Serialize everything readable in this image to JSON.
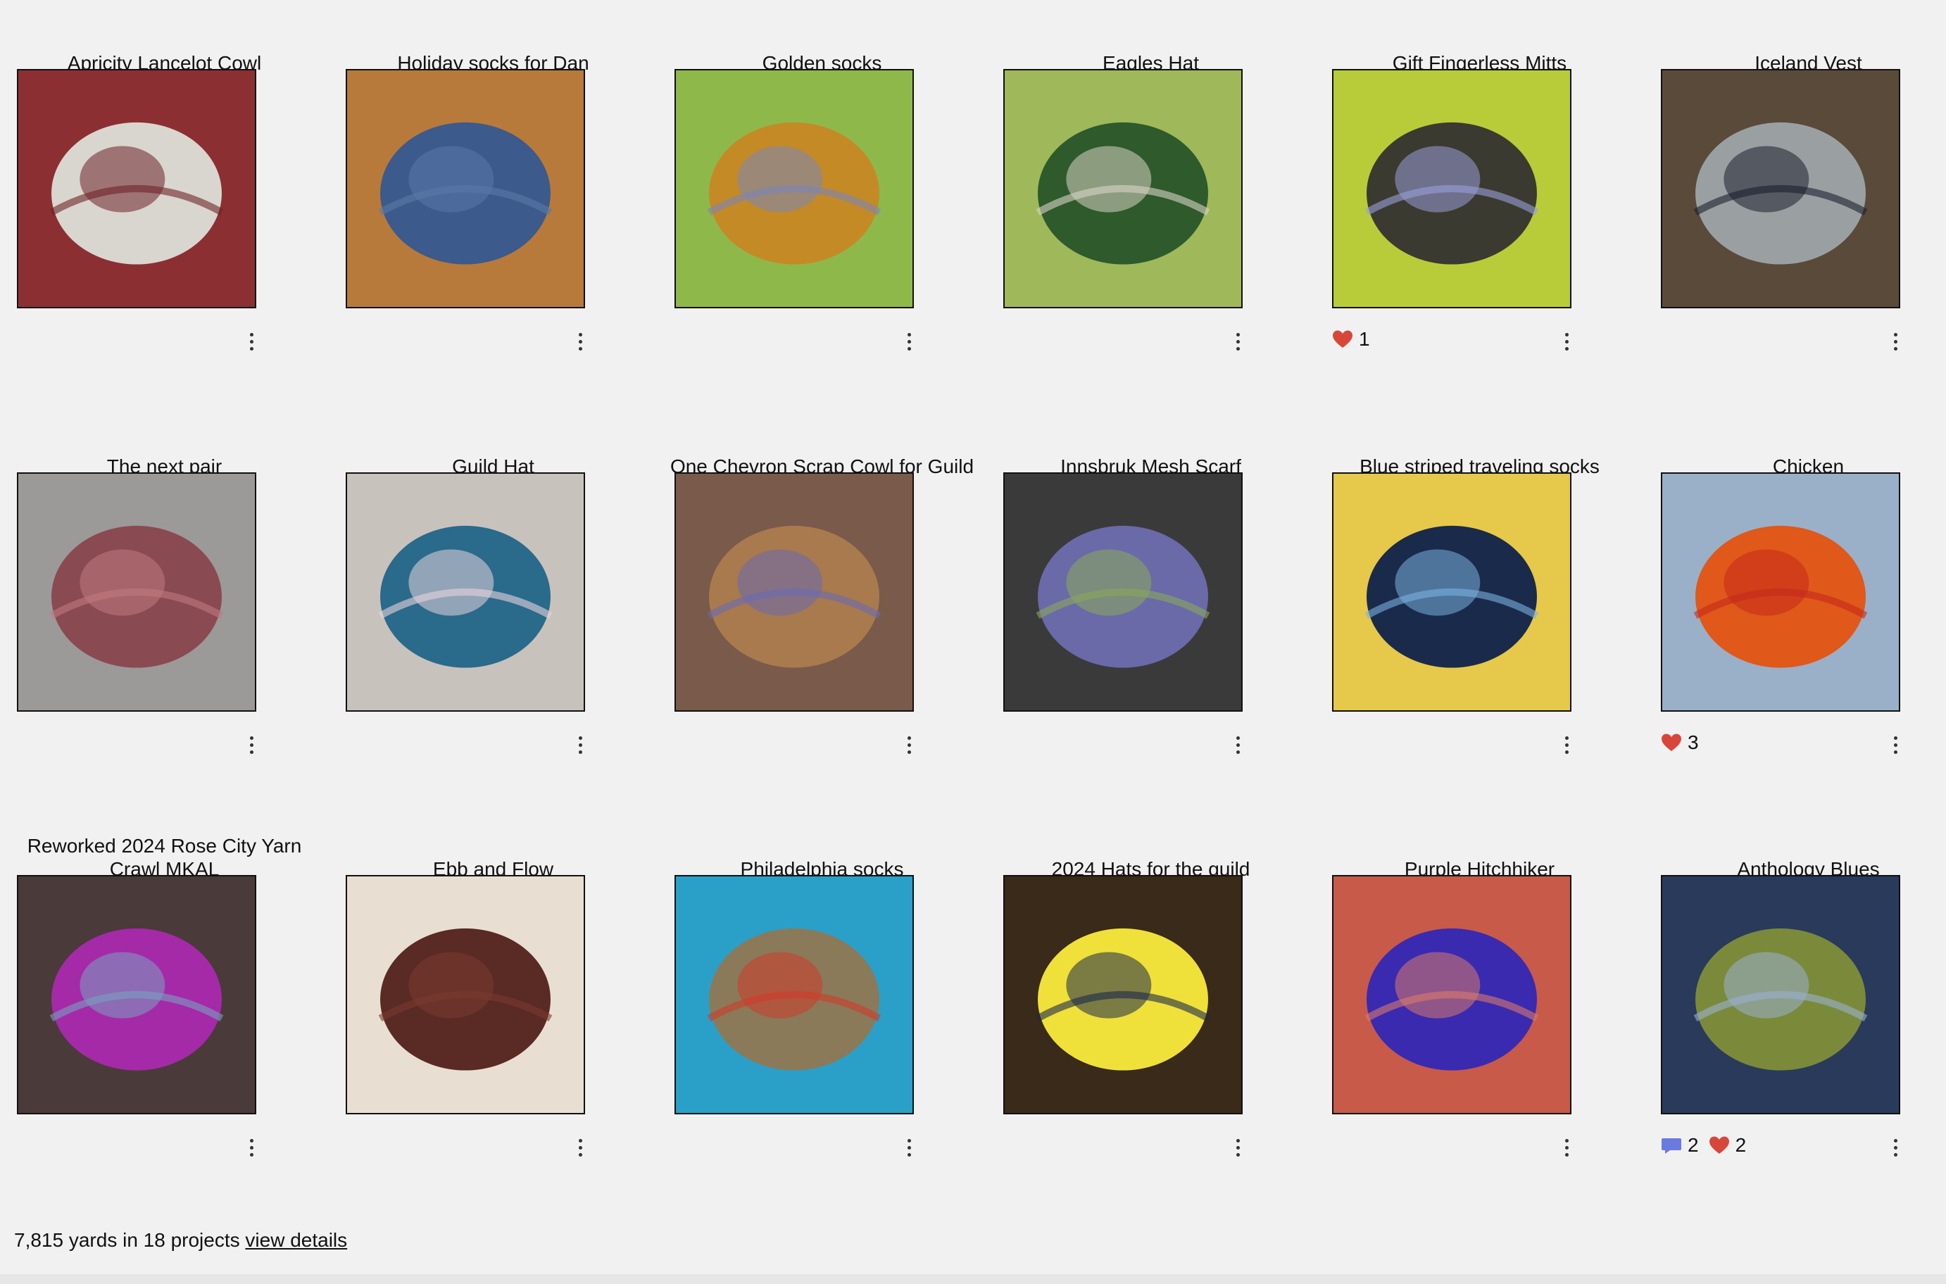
{
  "projects": [
    {
      "title": "Apricity Lancelot Cowl",
      "likes": "",
      "comments": "",
      "colors": [
        "#8b2f33",
        "#d9d6cf",
        "#6e2328"
      ]
    },
    {
      "title": "Holiday socks for Dan",
      "likes": "",
      "comments": "",
      "colors": [
        "#b87a3a",
        "#3c5a8c",
        "#5a79a8"
      ]
    },
    {
      "title": "Golden socks",
      "likes": "",
      "comments": "",
      "colors": [
        "#8fb84a",
        "#c48a26",
        "#7c86b8"
      ]
    },
    {
      "title": "Eagles Hat",
      "likes": "",
      "comments": "",
      "colors": [
        "#9fb85a",
        "#2e5a2c",
        "#d8d4c4"
      ]
    },
    {
      "title": "Gift Fingerless Mitts",
      "likes": "1",
      "comments": "",
      "colors": [
        "#b8cc3a",
        "#3b3a30",
        "#9a9fd8"
      ]
    },
    {
      "title": "Iceland Vest",
      "likes": "",
      "comments": "",
      "colors": [
        "#5a4a3a",
        "#9aa0a2",
        "#1c1f2e"
      ]
    },
    {
      "title": "The next pair",
      "likes": "",
      "comments": "",
      "colors": [
        "#9b9a98",
        "#8a4a52",
        "#c07a7e"
      ]
    },
    {
      "title": "Guild Hat",
      "likes": "",
      "comments": "",
      "colors": [
        "#c8c2bd",
        "#2a6a8a",
        "#e8d4dc"
      ]
    },
    {
      "title": "One Chevron Scrap Cowl for Guild",
      "likes": "",
      "comments": "",
      "colors": [
        "#7a5a4a",
        "#a87a4e",
        "#6a6ab0"
      ]
    },
    {
      "title": "Innsbruk Mesh Scarf",
      "likes": "",
      "comments": "",
      "colors": [
        "#3a3a3a",
        "#6a6aa8",
        "#8aa85a"
      ]
    },
    {
      "title": "Blue striped traveling socks",
      "likes": "",
      "comments": "",
      "colors": [
        "#e6c84a",
        "#1a2a4a",
        "#7ab0e0"
      ]
    },
    {
      "title": "Chicken",
      "likes": "3",
      "comments": "",
      "colors": [
        "#9ab0c8",
        "#e0581a",
        "#c42a1a"
      ]
    },
    {
      "title": "Reworked 2024 Rose City Yarn Crawl MKAL",
      "likes": "",
      "comments": "",
      "colors": [
        "#4a3a3a",
        "#a42aa8",
        "#7aa0c0"
      ]
    },
    {
      "title": "Ebb and Flow",
      "likes": "",
      "comments": "",
      "colors": [
        "#e8dfd2",
        "#5a2a24",
        "#7a3a30"
      ]
    },
    {
      "title": "Philadelphia socks",
      "likes": "",
      "comments": "",
      "colors": [
        "#2aa0c8",
        "#8a7a5a",
        "#d03a2a"
      ]
    },
    {
      "title": "2024 Hats for the guild",
      "likes": "",
      "comments": "",
      "colors": [
        "#3a2a1a",
        "#f0e03a",
        "#1a2a4a"
      ]
    },
    {
      "title": "Purple Hitchhiker",
      "likes": "",
      "comments": "",
      "colors": [
        "#c85a4a",
        "#3a2ab0",
        "#d87a6a"
      ]
    },
    {
      "title": "Anthology Blues",
      "likes": "2",
      "comments": "2",
      "colors": [
        "#2a3a5a",
        "#7a8a3a",
        "#9ab0d0"
      ]
    }
  ],
  "footer": {
    "summary": "7,815 yards in 18 projects",
    "link": "view details"
  },
  "colors": {
    "background": "#f1f1f1",
    "heart": "#d8463a",
    "comment": "#6a7adf"
  }
}
